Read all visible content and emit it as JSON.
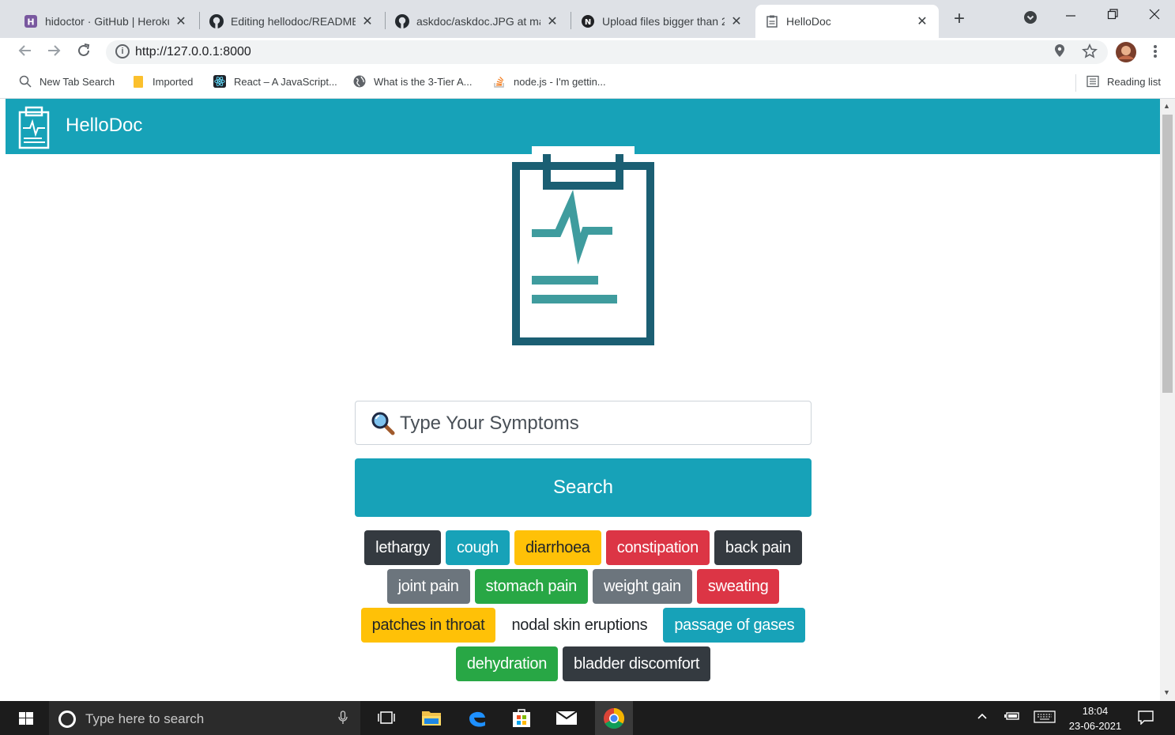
{
  "browser": {
    "tabs": [
      {
        "title": "hidoctor · GitHub | Heroku",
        "icon": "heroku-icon",
        "active": false
      },
      {
        "title": "Editing hellodoc/README",
        "icon": "github-icon",
        "active": false
      },
      {
        "title": "askdoc/askdoc.JPG at mai",
        "icon": "github-icon",
        "active": false
      },
      {
        "title": "Upload files bigger than 2",
        "icon": "notion-icon",
        "active": false
      },
      {
        "title": "HelloDoc",
        "icon": "clipboard-icon",
        "active": true
      }
    ],
    "close_glyph": "✕",
    "new_tab_glyph": "+",
    "url": "http://127.0.0.1:8000",
    "bookmarks": [
      {
        "label": "New Tab Search",
        "icon": "search-icon"
      },
      {
        "label": "Imported",
        "icon": "folder-icon"
      },
      {
        "label": "React – A JavaScript...",
        "icon": "react-icon"
      },
      {
        "label": "What is the 3-Tier A...",
        "icon": "globe-icon"
      },
      {
        "label": "node.js - I'm gettin...",
        "icon": "stackoverflow-icon"
      }
    ],
    "reading_list": "Reading list"
  },
  "app": {
    "brand": "HelloDoc",
    "accent_color": "#17a2b8",
    "search": {
      "placeholder": "Type Your Symptoms",
      "value": ""
    },
    "search_button": "Search",
    "symptom_rows": [
      [
        {
          "label": "lethargy",
          "bg": "#343a40",
          "fg": "#ffffff"
        },
        {
          "label": "cough",
          "bg": "#17a2b8",
          "fg": "#ffffff"
        },
        {
          "label": "diarrhoea",
          "bg": "#ffc107",
          "fg": "#212529"
        },
        {
          "label": "constipation",
          "bg": "#dc3545",
          "fg": "#ffffff"
        },
        {
          "label": "back pain",
          "bg": "#343a40",
          "fg": "#ffffff"
        }
      ],
      [
        {
          "label": "joint pain",
          "bg": "#6c757d",
          "fg": "#ffffff"
        },
        {
          "label": "stomach pain",
          "bg": "#28a745",
          "fg": "#ffffff"
        },
        {
          "label": "weight gain",
          "bg": "#6c757d",
          "fg": "#ffffff"
        },
        {
          "label": "sweating",
          "bg": "#dc3545",
          "fg": "#ffffff"
        }
      ],
      [
        {
          "label": "patches in throat",
          "bg": "#ffc107",
          "fg": "#212529"
        },
        {
          "label": "nodal skin eruptions",
          "bg": "#ffffff",
          "fg": "#212529"
        },
        {
          "label": "passage of gases",
          "bg": "#17a2b8",
          "fg": "#ffffff"
        }
      ],
      [
        {
          "label": "dehydration",
          "bg": "#28a745",
          "fg": "#ffffff"
        },
        {
          "label": "bladder discomfort",
          "bg": "#343a40",
          "fg": "#ffffff"
        }
      ]
    ]
  },
  "taskbar": {
    "search_placeholder": "Type here to search",
    "time": "18:04",
    "date": "23-06-2021"
  }
}
